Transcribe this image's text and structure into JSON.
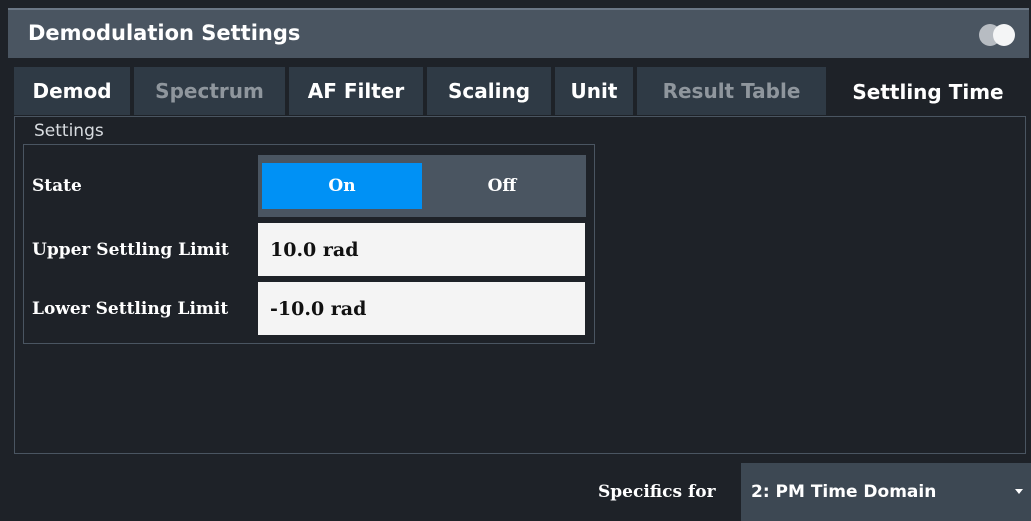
{
  "dialog": {
    "title": "Demodulation Settings"
  },
  "tabs": [
    {
      "label": "Demod",
      "state": "normal"
    },
    {
      "label": "Spectrum",
      "state": "disabled"
    },
    {
      "label": "AF Filter",
      "state": "normal"
    },
    {
      "label": "Scaling",
      "state": "normal"
    },
    {
      "label": "Unit",
      "state": "normal"
    },
    {
      "label": "Result Table",
      "state": "disabled"
    },
    {
      "label": "Settling Time",
      "state": "active"
    }
  ],
  "settings": {
    "group_label": "Settings",
    "state_label": "State",
    "state_on": "On",
    "state_off": "Off",
    "state_selected": "On",
    "upper_label": "Upper Settling Limit",
    "upper_value": "10.0 rad",
    "lower_label": "Lower Settling Limit",
    "lower_value": "-10.0 rad"
  },
  "footer": {
    "specifics_label": "Specifics for",
    "specifics_value": "2: PM Time Domain"
  },
  "icons": {
    "toggle": "toggle-icon",
    "dropdown": "chevron-down-icon"
  },
  "colors": {
    "accent": "#0091f5",
    "titlebar": "#4a5561",
    "background": "#1e2228",
    "tab": "#2f3a45"
  }
}
